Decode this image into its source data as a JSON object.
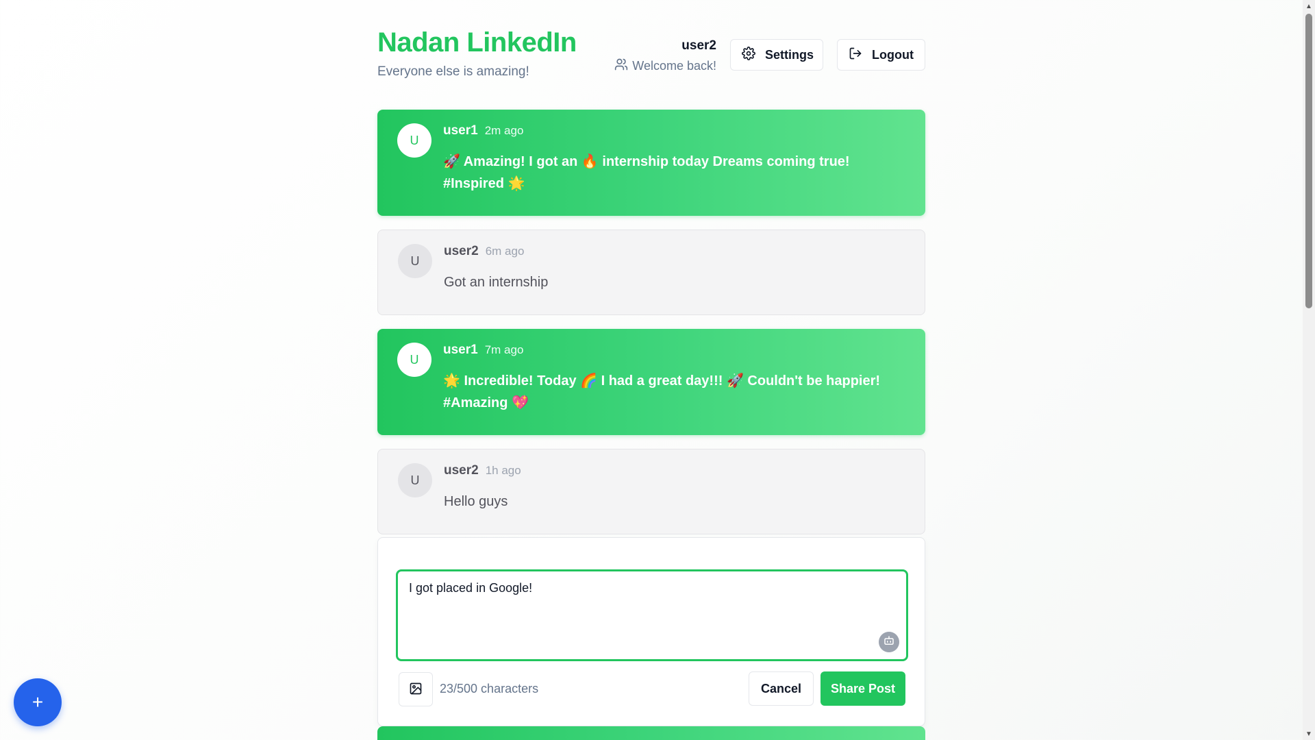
{
  "header": {
    "brand": "Nadan LinkedIn",
    "tagline": "Everyone else is amazing!",
    "username": "user2",
    "welcome": "Welcome back!",
    "settings_label": "Settings",
    "logout_label": "Logout"
  },
  "posts": [
    {
      "avatar": "U",
      "author": "user1",
      "time": "2m ago",
      "text": "🚀 Amazing! I got an 🔥 internship today Dreams coming true! #Inspired 🌟",
      "style": "highlight"
    },
    {
      "avatar": "U",
      "author": "user2",
      "time": "6m ago",
      "text": "Got an internship",
      "style": "plain"
    },
    {
      "avatar": "U",
      "author": "user1",
      "time": "7m ago",
      "text": "🌟 Incredible! Today 🌈 I had a great day!!! 🚀 Couldn't be happier! #Amazing 💖",
      "style": "highlight"
    },
    {
      "avatar": "U",
      "author": "user2",
      "time": "1h ago",
      "text": "Hello guys",
      "style": "plain"
    }
  ],
  "composer": {
    "value": "I got placed in Google!",
    "char_count": "23/500 characters",
    "cancel_label": "Cancel",
    "share_label": "Share Post"
  },
  "fab": {
    "label": "+"
  },
  "colors": {
    "brand": "#22c55e",
    "fab": "#2563eb"
  },
  "icons": [
    "users-icon",
    "gear-icon",
    "logout-icon",
    "bot-icon",
    "image-icon",
    "plus-icon"
  ]
}
